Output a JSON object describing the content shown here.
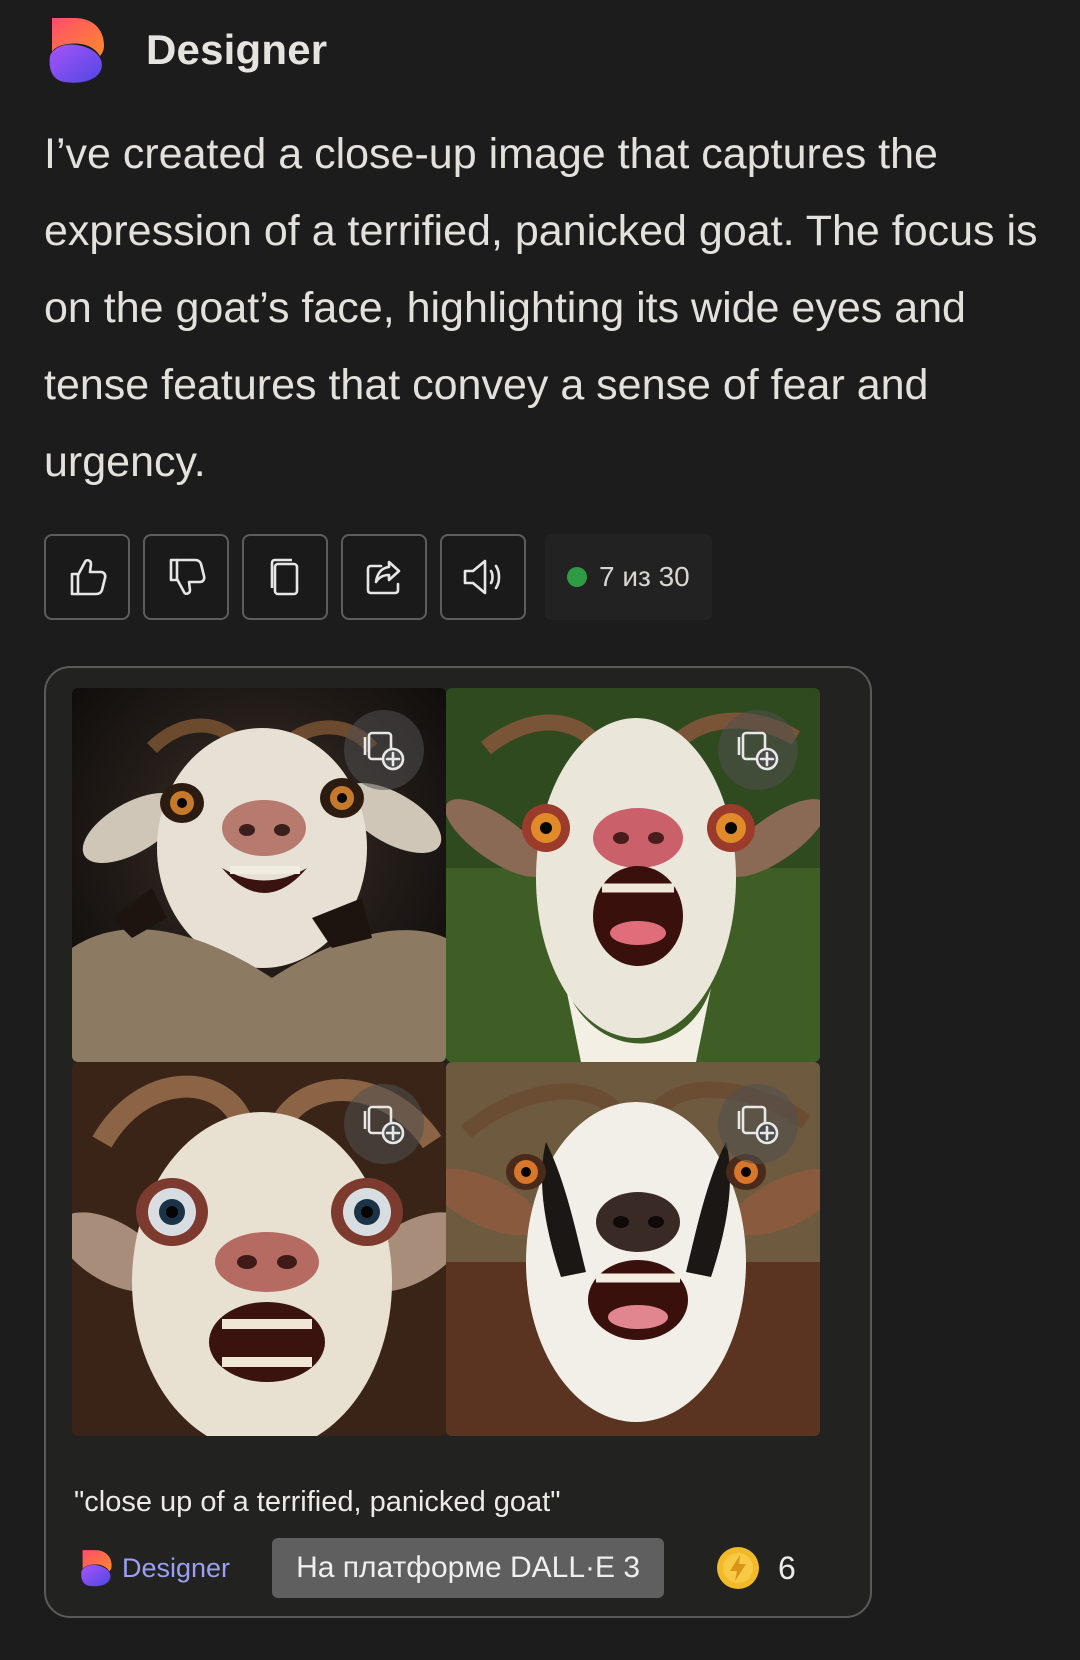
{
  "header": {
    "app_name": "Designer"
  },
  "message": {
    "text": "I’ve created a close-up image that captures the expression of a terrified, panicked goat. The focus is on the goat’s face, highlighting its wide eyes and tense features that convey a sense of fear and urgency."
  },
  "actions": {
    "buttons": [
      {
        "icon": "thumbs-up-icon"
      },
      {
        "icon": "thumbs-down-icon"
      },
      {
        "icon": "copy-icon"
      },
      {
        "icon": "share-icon"
      },
      {
        "icon": "speaker-icon"
      }
    ],
    "counter": "7 из 30",
    "counter_dot_color": "#2f9b45"
  },
  "image_card": {
    "images": [
      {
        "icon": "add-to-collection-icon"
      },
      {
        "icon": "add-to-collection-icon"
      },
      {
        "icon": "add-to-collection-icon"
      },
      {
        "icon": "add-to-collection-icon"
      }
    ],
    "prompt": "\"close up of a terrified, panicked goat\"",
    "footer": {
      "brand": "Designer",
      "platform_label": "На платформе DALL·E 3",
      "boost_count": "6"
    }
  },
  "colors": {
    "background": "#1c1c1c",
    "card_background": "#222220",
    "brand_link": "#9c9ff5",
    "platform_button": "#5f5f5f",
    "boost": "#f2b928"
  }
}
